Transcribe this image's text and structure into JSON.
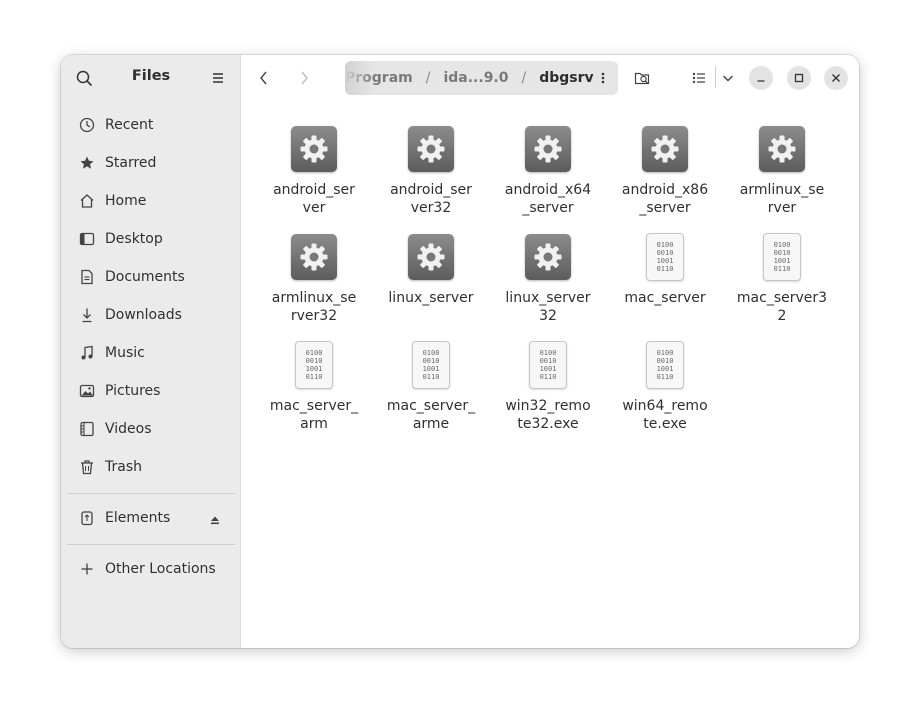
{
  "sidebar": {
    "title": "Files",
    "items": [
      {
        "label": "Recent",
        "icon": "clock-icon"
      },
      {
        "label": "Starred",
        "icon": "star-icon"
      },
      {
        "label": "Home",
        "icon": "home-icon"
      },
      {
        "label": "Desktop",
        "icon": "desktop-icon"
      },
      {
        "label": "Documents",
        "icon": "document-icon"
      },
      {
        "label": "Downloads",
        "icon": "download-icon"
      },
      {
        "label": "Music",
        "icon": "music-icon"
      },
      {
        "label": "Pictures",
        "icon": "picture-icon"
      },
      {
        "label": "Videos",
        "icon": "video-icon"
      },
      {
        "label": "Trash",
        "icon": "trash-icon"
      }
    ],
    "devices": [
      {
        "label": "Elements",
        "icon": "usb-drive-icon"
      }
    ],
    "other_locations": {
      "label": "Other Locations",
      "icon": "plus-icon"
    }
  },
  "path": {
    "crumbs": [
      "Program",
      "ida...9.0",
      "dbgsrv"
    ],
    "separator": "/"
  },
  "files": [
    {
      "name": "android_ser\nver",
      "type": "executable"
    },
    {
      "name": "android_ser\nver32",
      "type": "executable"
    },
    {
      "name": "android_x64\n_server",
      "type": "executable"
    },
    {
      "name": "android_x86\n_server",
      "type": "executable"
    },
    {
      "name": "armlinux_se\nrver",
      "type": "executable"
    },
    {
      "name": "armlinux_se\nrver32",
      "type": "executable"
    },
    {
      "name": "linux_server",
      "type": "executable"
    },
    {
      "name": "linux_server\n32",
      "type": "executable"
    },
    {
      "name": "mac_server",
      "type": "binary"
    },
    {
      "name": "mac_server3\n2",
      "type": "binary"
    },
    {
      "name": "mac_server_\narm",
      "type": "binary"
    },
    {
      "name": "mac_server_\narme",
      "type": "binary"
    },
    {
      "name": "win32_remo\nte32.exe",
      "type": "binary"
    },
    {
      "name": "win64_remo\nte.exe",
      "type": "binary"
    }
  ],
  "binary_glyph": [
    "0100",
    "0010",
    "1001",
    "0110"
  ]
}
